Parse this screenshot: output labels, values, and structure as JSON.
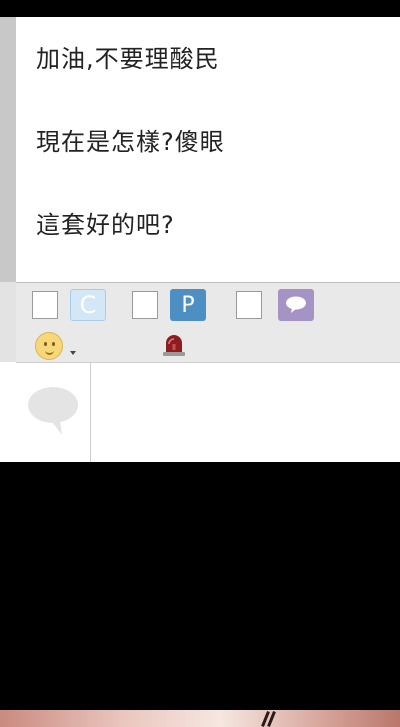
{
  "messages": [
    {
      "text": "加油,不要理酸民"
    },
    {
      "text": "現在是怎樣?傻眼"
    },
    {
      "text": "這套好的吧?"
    }
  ],
  "toolbar": {
    "options": [
      {
        "icon": "c-icon",
        "letter": "C",
        "color": "#d3e7f6"
      },
      {
        "icon": "p-icon",
        "letter": "P",
        "color": "#4e8fc3"
      },
      {
        "icon": "speech-bubble-icon",
        "letter": "",
        "color": "#a493c4"
      }
    ]
  },
  "actions": {
    "emoji_icon": "smiley-icon",
    "report_icon": "siren-icon"
  },
  "compose": {
    "placeholder": "",
    "avatar_icon": "speech-bubble-icon"
  }
}
